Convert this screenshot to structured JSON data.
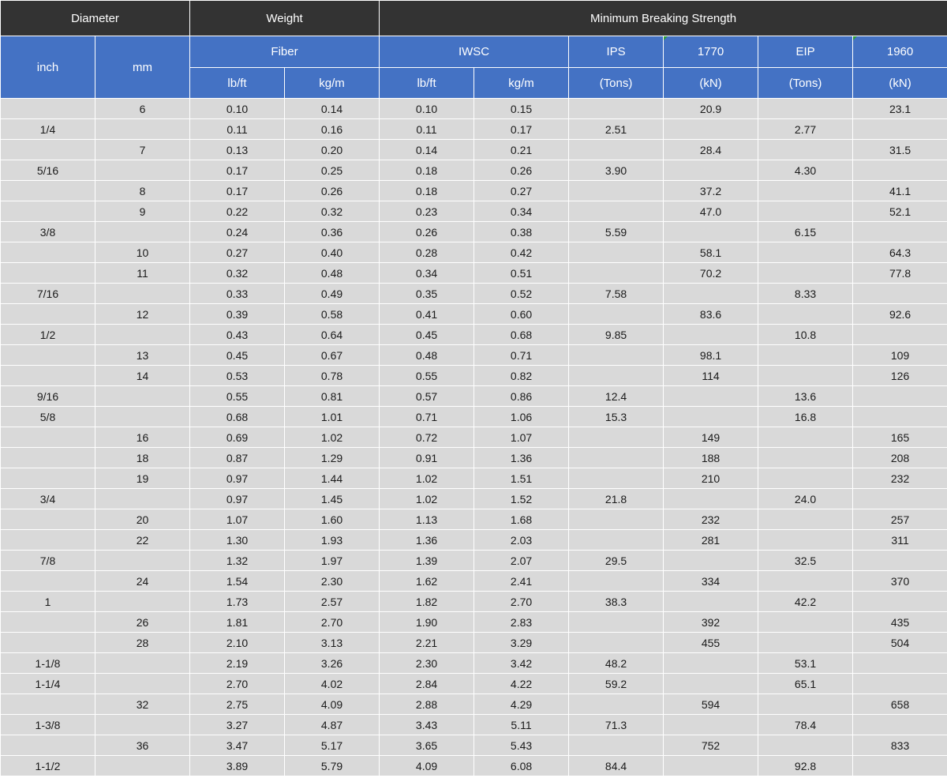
{
  "header": {
    "diameter": "Diameter",
    "weight": "Weight",
    "mbs": "Minimum Breaking Strength",
    "inch": "inch",
    "mm": "mm",
    "fiber": "Fiber",
    "iwsc": "IWSC",
    "ips": "IPS",
    "g1770": "1770",
    "eip": "EIP",
    "g1960": "1960",
    "fiber_lbft": "lb/ft",
    "fiber_kgm": "kg/m",
    "iwsc_lbft": "lb/ft",
    "iwsc_kgm": "kg/m",
    "ips_unit": "(Tons)",
    "g1770_unit": "(kN)",
    "eip_unit": "(Tons)",
    "g1960_unit": "(kN)"
  },
  "rows": [
    [
      "",
      "6",
      "0.10",
      "0.14",
      "0.10",
      "0.15",
      "",
      "20.9",
      "",
      "23.1"
    ],
    [
      "1/4",
      "",
      "0.11",
      "0.16",
      "0.11",
      "0.17",
      "2.51",
      "",
      "2.77",
      ""
    ],
    [
      "",
      "7",
      "0.13",
      "0.20",
      "0.14",
      "0.21",
      "",
      "28.4",
      "",
      "31.5"
    ],
    [
      "5/16",
      "",
      "0.17",
      "0.25",
      "0.18",
      "0.26",
      "3.90",
      "",
      "4.30",
      ""
    ],
    [
      "",
      "8",
      "0.17",
      "0.26",
      "0.18",
      "0.27",
      "",
      "37.2",
      "",
      "41.1"
    ],
    [
      "",
      "9",
      "0.22",
      "0.32",
      "0.23",
      "0.34",
      "",
      "47.0",
      "",
      "52.1"
    ],
    [
      "3/8",
      "",
      "0.24",
      "0.36",
      "0.26",
      "0.38",
      "5.59",
      "",
      "6.15",
      ""
    ],
    [
      "",
      "10",
      "0.27",
      "0.40",
      "0.28",
      "0.42",
      "",
      "58.1",
      "",
      "64.3"
    ],
    [
      "",
      "11",
      "0.32",
      "0.48",
      "0.34",
      "0.51",
      "",
      "70.2",
      "",
      "77.8"
    ],
    [
      "7/16",
      "",
      "0.33",
      "0.49",
      "0.35",
      "0.52",
      "7.58",
      "",
      "8.33",
      ""
    ],
    [
      "",
      "12",
      "0.39",
      "0.58",
      "0.41",
      "0.60",
      "",
      "83.6",
      "",
      "92.6"
    ],
    [
      "1/2",
      "",
      "0.43",
      "0.64",
      "0.45",
      "0.68",
      "9.85",
      "",
      "10.8",
      ""
    ],
    [
      "",
      "13",
      "0.45",
      "0.67",
      "0.48",
      "0.71",
      "",
      "98.1",
      "",
      "109"
    ],
    [
      "",
      "14",
      "0.53",
      "0.78",
      "0.55",
      "0.82",
      "",
      "114",
      "",
      "126"
    ],
    [
      "9/16",
      "",
      "0.55",
      "0.81",
      "0.57",
      "0.86",
      "12.4",
      "",
      "13.6",
      ""
    ],
    [
      "5/8",
      "",
      "0.68",
      "1.01",
      "0.71",
      "1.06",
      "15.3",
      "",
      "16.8",
      ""
    ],
    [
      "",
      "16",
      "0.69",
      "1.02",
      "0.72",
      "1.07",
      "",
      "149",
      "",
      "165"
    ],
    [
      "",
      "18",
      "0.87",
      "1.29",
      "0.91",
      "1.36",
      "",
      "188",
      "",
      "208"
    ],
    [
      "",
      "19",
      "0.97",
      "1.44",
      "1.02",
      "1.51",
      "",
      "210",
      "",
      "232"
    ],
    [
      "3/4",
      "",
      "0.97",
      "1.45",
      "1.02",
      "1.52",
      "21.8",
      "",
      "24.0",
      ""
    ],
    [
      "",
      "20",
      "1.07",
      "1.60",
      "1.13",
      "1.68",
      "",
      "232",
      "",
      "257"
    ],
    [
      "",
      "22",
      "1.30",
      "1.93",
      "1.36",
      "2.03",
      "",
      "281",
      "",
      "311"
    ],
    [
      "7/8",
      "",
      "1.32",
      "1.97",
      "1.39",
      "2.07",
      "29.5",
      "",
      "32.5",
      ""
    ],
    [
      "",
      "24",
      "1.54",
      "2.30",
      "1.62",
      "2.41",
      "",
      "334",
      "",
      "370"
    ],
    [
      "1",
      "",
      "1.73",
      "2.57",
      "1.82",
      "2.70",
      "38.3",
      "",
      "42.2",
      ""
    ],
    [
      "",
      "26",
      "1.81",
      "2.70",
      "1.90",
      "2.83",
      "",
      "392",
      "",
      "435"
    ],
    [
      "",
      "28",
      "2.10",
      "3.13",
      "2.21",
      "3.29",
      "",
      "455",
      "",
      "504"
    ],
    [
      "1-1/8",
      "",
      "2.19",
      "3.26",
      "2.30",
      "3.42",
      "48.2",
      "",
      "53.1",
      ""
    ],
    [
      "1-1/4",
      "",
      "2.70",
      "4.02",
      "2.84",
      "4.22",
      "59.2",
      "",
      "65.1",
      ""
    ],
    [
      "",
      "32",
      "2.75",
      "4.09",
      "2.88",
      "4.29",
      "",
      "594",
      "",
      "658"
    ],
    [
      "1-3/8",
      "",
      "3.27",
      "4.87",
      "3.43",
      "5.11",
      "71.3",
      "",
      "78.4",
      ""
    ],
    [
      "",
      "36",
      "3.47",
      "5.17",
      "3.65",
      "5.43",
      "",
      "752",
      "",
      "833"
    ],
    [
      "1-1/2",
      "",
      "3.89",
      "5.79",
      "4.09",
      "6.08",
      "84.4",
      "",
      "92.8",
      ""
    ]
  ]
}
